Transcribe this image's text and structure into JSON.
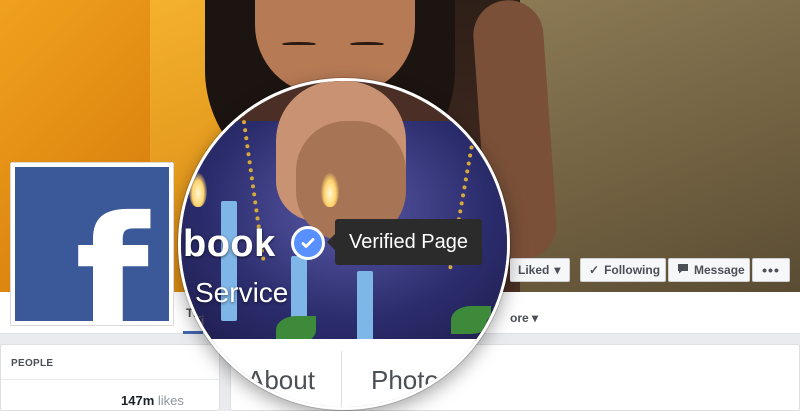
{
  "page": {
    "name_visible": "book",
    "category": "Service",
    "verified_tooltip": "Verified Page"
  },
  "actions": {
    "liked_label": "Liked",
    "following_label": "Following",
    "message_label": "Message",
    "more_label": "•••"
  },
  "tabs": {
    "first_visible": "Ti",
    "more_label": "ore"
  },
  "sections": {
    "about_label": "About",
    "photos_label": "Photos"
  },
  "people": {
    "header": "PEOPLE",
    "likes_count": "147m",
    "likes_suffix": "likes"
  },
  "icons": {
    "verified": "verified-check-icon",
    "checkmark": "checkmark-icon",
    "message": "message-icon",
    "dropdown": "caret-down-icon",
    "logo": "facebook-logo"
  },
  "colors": {
    "brand": "#3b5998",
    "verified": "#5890ff",
    "tooltip": "#2b2b2b",
    "background": "#e9ebee"
  }
}
